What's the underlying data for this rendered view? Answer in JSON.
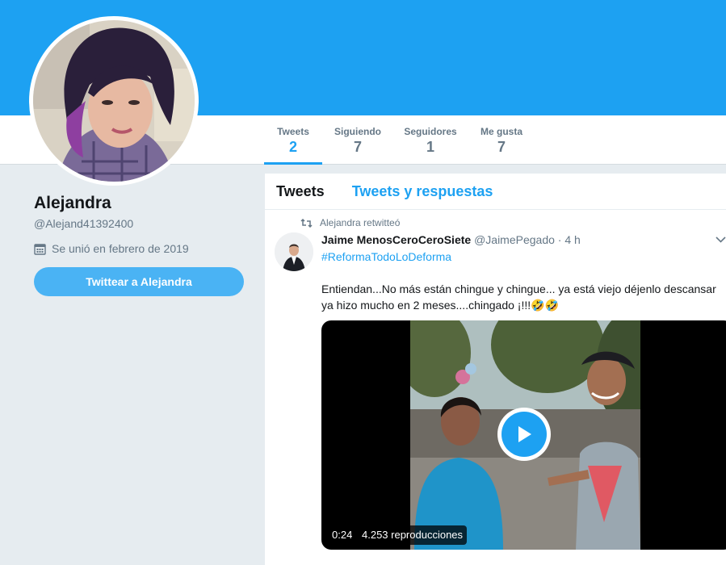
{
  "colors": {
    "banner": "#1da1f2",
    "accent": "#1da1f2",
    "button": "#4ab3f4",
    "page_background": "#e6ecf0"
  },
  "nav": {
    "stats": [
      {
        "label": "Tweets",
        "value": "2",
        "active": true
      },
      {
        "label": "Siguiendo",
        "value": "7",
        "active": false
      },
      {
        "label": "Seguidores",
        "value": "1",
        "active": false
      },
      {
        "label": "Me gusta",
        "value": "7",
        "active": false
      }
    ]
  },
  "profile": {
    "name": "Alejandra",
    "handle": "@Alejand41392400",
    "joined": "Se unió en febrero de 2019",
    "joined_icon": "calendar-icon",
    "tweet_to_button": "Twittear a Alejandra"
  },
  "timeline": {
    "tabs": [
      {
        "label": "Tweets",
        "active": true
      },
      {
        "label": "Tweets y respuestas",
        "active": false
      }
    ],
    "tweet": {
      "retweet_label": "Alejandra retwitteó",
      "retweet_icon": "retweet-icon",
      "author_name": "Jaime MenosCeroCeroSiete",
      "author_handle": "@JaimePegado",
      "separator": "·",
      "time": "4 h",
      "menu_icon": "chevron-down-icon",
      "hashtag": "#ReformaTodoLoDeforma",
      "text": "Entiendan...No más están chingue y chingue... ya está viejo déjenlo descansar ya hizo mucho en 2 meses....chingado ¡!!!🤣🤣",
      "video": {
        "duration": "0:24",
        "views": "4.253 reproducciones",
        "play_icon": "play-icon"
      }
    }
  }
}
